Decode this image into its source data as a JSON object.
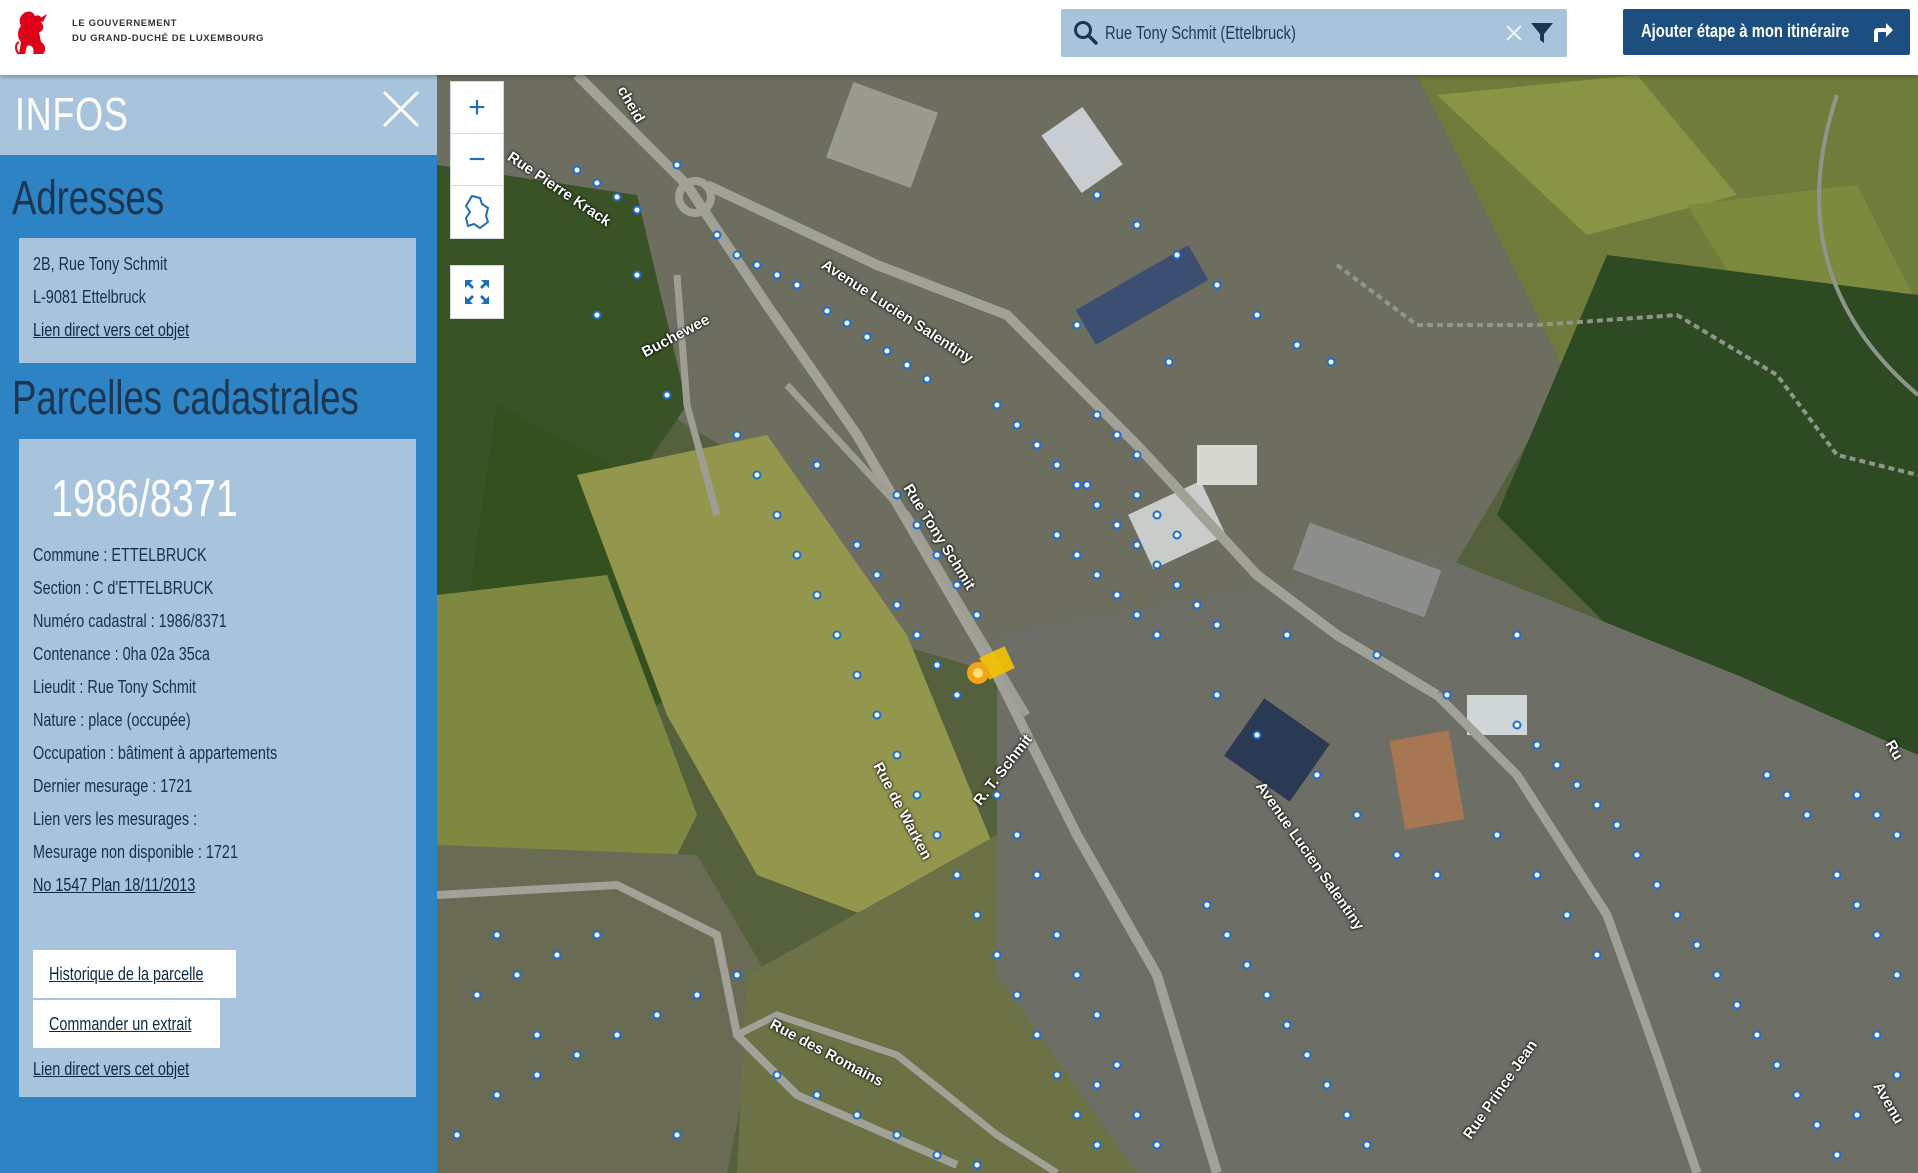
{
  "header": {
    "gov_line1": "Le Gouvernement",
    "gov_line2": "du Grand-Duché de Luxembourg",
    "search_value": "Rue Tony Schmit (Ettelbruck)",
    "itinerary_button": "Ajouter étape à mon itinéraire"
  },
  "sidebar": {
    "title": "INFOS",
    "addresses": {
      "heading": "Adresses",
      "line1": "2B, Rue Tony Schmit",
      "line2": "L-9081 Ettelbruck",
      "link": "Lien direct vers cet objet"
    },
    "parcels": {
      "heading": "Parcelles cadastrales",
      "number": "1986/8371",
      "details": [
        "Commune : ETTELBRUCK",
        "Section : C d'ETTELBRUCK",
        "Numéro cadastral : 1986/8371",
        "Contenance : 0ha 02a 35ca",
        "Lieudit : Rue Tony Schmit",
        "Nature : place (occupée)",
        "Occupation : bâtiment à appartements",
        "Dernier mesurage : 1721",
        "Lien vers les mesurages :",
        "Mesurage non disponible : 1721"
      ],
      "plan_link": "No 1547 Plan 18/11/2013",
      "history_button": "Historique de la parcelle",
      "order_button": "Commander un extrait",
      "direct_link": "Lien direct vers cet objet"
    }
  },
  "map": {
    "zoom_in": "+",
    "zoom_out": "−",
    "streets": [
      "Rue Pierre Krack",
      "Avenue Lucien Salentiny",
      "Buchewee",
      "Rue Tony Schmit",
      "R. T. Schmit",
      "Rue de Warken",
      "Avenue Lucien Salentiny",
      "Rue des Romains",
      "Rue Prince Jean",
      "cheid",
      "Ru",
      "Avenu"
    ]
  },
  "colors": {
    "accent": "#2d83c3",
    "panel": "#a7c4dc",
    "header_button": "#1c4f80"
  }
}
